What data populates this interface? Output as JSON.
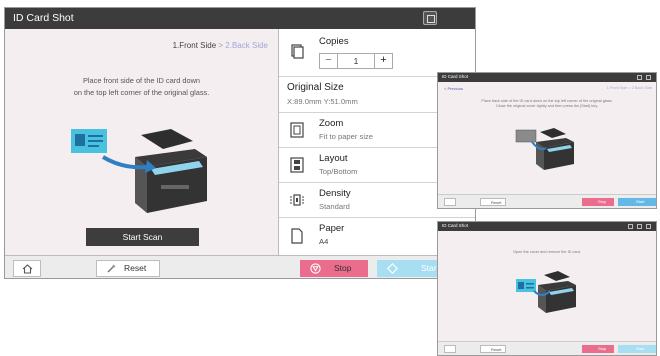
{
  "main": {
    "title": "ID Card Shot",
    "steps": {
      "step1": "1.Front Side",
      "separator": ">",
      "step2": "2.Back Side"
    },
    "instruction": [
      "Place front side of the ID card down",
      "on the top left corner of the original glass."
    ],
    "start_scan_label": "Start Scan",
    "options": {
      "copies": {
        "label": "Copies",
        "count": "1",
        "minus": "−",
        "plus": "+"
      },
      "original_size": {
        "label": "Original Size",
        "value": "X:89.0mm  Y:51.0mm"
      },
      "zoom": {
        "label": "Zoom",
        "value": "Fit to paper size"
      },
      "layout": {
        "label": "Layout",
        "value": "Top/Bottom"
      },
      "density": {
        "label": "Density",
        "value": "Standard"
      },
      "paper": {
        "label": "Paper",
        "value": "A4"
      }
    },
    "bottom": {
      "reset_label": "Reset",
      "stop_label": "Stop",
      "start_label": "Start"
    }
  },
  "mini1": {
    "title": "ID Card Shot",
    "prev_label": "< Previous",
    "steps": "1.Front Side > 2.Back Side",
    "instruction": [
      "Place back side of the ID card down on the top left corner of the original glass.",
      "Close the original cover tightly and then press the [Start] key."
    ],
    "reset_label": "Reset",
    "stop_label": "Stop",
    "start_label": "Start"
  },
  "mini2": {
    "title": "ID Card Shot",
    "instruction": [
      "Open the cover and remove the ID card."
    ],
    "reset_label": "Reset",
    "stop_label": "Stop",
    "start_label": "Start"
  },
  "colors": {
    "title_bar": "#3c3c3c",
    "left_bg": "#f5eef0",
    "stop": "#ea6d8d",
    "start_disabled": "#a8def1",
    "start_active": "#64b8e6",
    "id_card": "#49c2e0",
    "step_inactive": "#9fa8d5"
  },
  "icons": [
    "copies-icon",
    "zoom-icon",
    "layout-icon",
    "density-icon",
    "paper-icon",
    "home-icon",
    "reset-icon",
    "stop-icon",
    "start-icon",
    "scanner-icon",
    "id-card-icon"
  ]
}
